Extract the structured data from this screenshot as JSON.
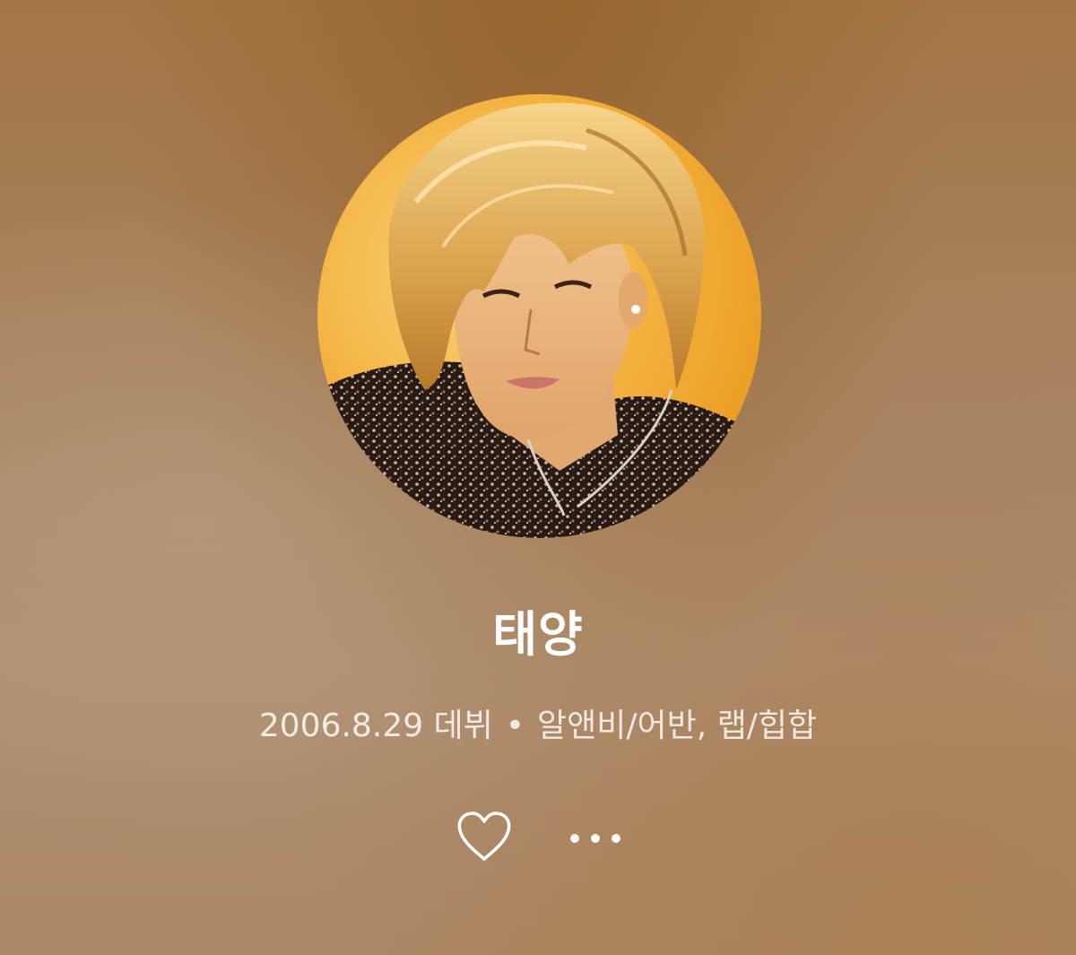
{
  "artist": {
    "name": "태양",
    "debut": "2006.8.29 데뷔",
    "separator": "•",
    "genres": "알앤비/어반, 랩/힙합"
  },
  "actions": {
    "like_icon": "heart-outline-icon",
    "more_icon": "more-horizontal-icon"
  },
  "colors": {
    "background_top": "#a37645",
    "background_bottom": "#ab8866",
    "photo_backdrop": "#f4b23a",
    "text_primary": "#ffffff"
  }
}
